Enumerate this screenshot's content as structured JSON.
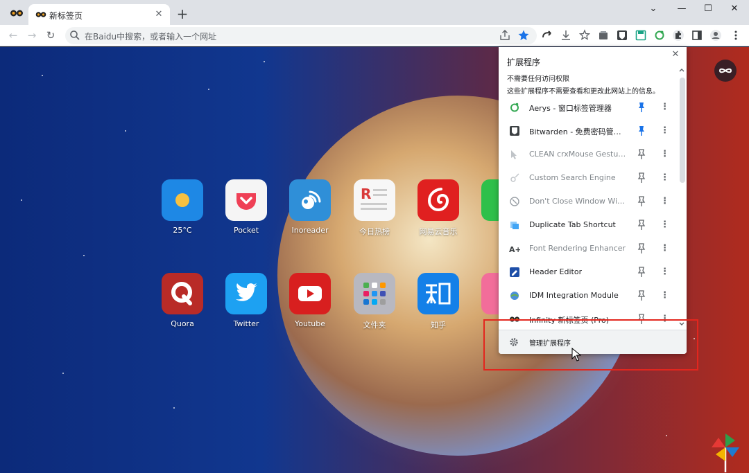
{
  "window": {
    "tab_title": "新标签页",
    "new_tab_glyph": "+",
    "tab_close_glyph": "✕",
    "controls": {
      "minimize": "⌄",
      "restore": "—",
      "maximize": "☐",
      "close": "✕"
    }
  },
  "toolbar": {
    "back_glyph": "←",
    "forward_glyph": "→",
    "reload_glyph": "↻",
    "omnibox_placeholder": "在Baidu中搜索，或者输入一个网址",
    "icons": [
      "share-icon",
      "star-icon",
      "send-icon",
      "download-icon",
      "star-list-icon",
      "extension-box-icon",
      "bitwarden-icon",
      "save-icon",
      "aerys-icon",
      "puzzle-icon",
      "sidebar-icon",
      "profile-icon",
      "menu-icon"
    ]
  },
  "apps": [
    {
      "label": "25°C",
      "icon": "weather-sun-icon",
      "color": "#1e88e5"
    },
    {
      "label": "Pocket",
      "icon": "pocket-icon",
      "color": "#f5f5f5"
    },
    {
      "label": "Inoreader",
      "icon": "inoreader-icon",
      "color": "#2f8fd8"
    },
    {
      "label": "今日热榜",
      "icon": "rebang-icon",
      "color": "#f7f7f7"
    },
    {
      "label": "网易云音乐",
      "icon": "netease-music-icon",
      "color": "#e02020"
    },
    {
      "label": "Quora",
      "icon": "quora-icon",
      "color": "#b92b27"
    },
    {
      "label": "Twitter",
      "icon": "twitter-icon",
      "color": "#1da1f2"
    },
    {
      "label": "Youtube",
      "icon": "youtube-icon",
      "color": "#d81f1f"
    },
    {
      "label": "文件夹",
      "icon": "folder-icon",
      "color": "#b8b8c0"
    },
    {
      "label": "知乎",
      "icon": "zhihu-icon",
      "color": "#1480e8"
    }
  ],
  "extensions_popup": {
    "title": "扩展程序",
    "close_glyph": "✕",
    "section_title": "不需要任何访问权限",
    "section_desc": "这些扩展程序不需要查看和更改此网站上的信息。",
    "items": [
      {
        "name": "Aerys - 窗口标签管理器",
        "pinned": true,
        "dim": false,
        "icon": "aerys-icon"
      },
      {
        "name": "Bitwarden - 免费密码管理器",
        "pinned": true,
        "dim": false,
        "icon": "bitwarden-icon"
      },
      {
        "name": "CLEAN crxMouse Gestures",
        "pinned": false,
        "dim": true,
        "icon": "crxmouse-icon"
      },
      {
        "name": "Custom Search Engine",
        "pinned": false,
        "dim": true,
        "icon": "search-engine-icon"
      },
      {
        "name": "Don't Close Window With...",
        "pinned": false,
        "dim": true,
        "icon": "dont-close-icon"
      },
      {
        "name": "Duplicate Tab Shortcut",
        "pinned": false,
        "dim": false,
        "icon": "duplicate-tab-icon"
      },
      {
        "name": "Font Rendering Enhancer",
        "pinned": false,
        "dim": true,
        "icon": "font-enhancer-icon"
      },
      {
        "name": "Header Editor",
        "pinned": false,
        "dim": false,
        "icon": "header-editor-icon"
      },
      {
        "name": "IDM Integration Module",
        "pinned": false,
        "dim": false,
        "icon": "idm-icon"
      },
      {
        "name": "Infinity 新标签页 (Pro)",
        "pinned": false,
        "dim": false,
        "icon": "infinity-icon"
      }
    ],
    "more_glyph": "⋮",
    "manage_label": "管理扩展程序"
  },
  "colors": {
    "highlight": "#e3261e",
    "pin_active": "#1a73e8",
    "pin_inactive": "#5f6368"
  }
}
